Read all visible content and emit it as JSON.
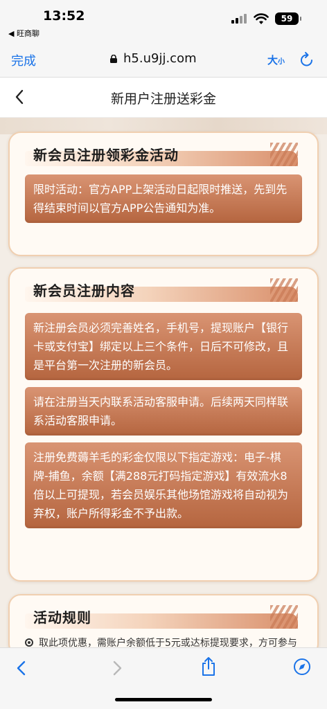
{
  "status": {
    "time": "13:52",
    "back_app": "◀ 旺商聊",
    "battery": "59"
  },
  "browser": {
    "done": "完成",
    "url": "h5.u9jj.com",
    "text_size_big": "大",
    "text_size_small": "小"
  },
  "header": {
    "title": "新用户注册送彩金"
  },
  "cards": [
    {
      "title": "新会员注册领彩金活动",
      "paragraphs": [
        "限时活动：官方APP上架活动日起限时推送，先到先得结束时间以官方APP公告通知为准。"
      ]
    },
    {
      "title": "新会员注册内容",
      "paragraphs": [
        "新注册会员必须完善姓名，手机号，提现账户【银行卡或支付宝】绑定以上三个条件，日后不可修改，且是平台第一次注册的新会员。",
        "请在注册当天内联系活动客服申请。后续两天同样联系活动客服申请。",
        "注册免费薅羊毛的彩金仅限以下指定游戏：电子-棋牌-捕鱼，余额【满288元打码指定游戏】有效流水8倍以上可提现，若会员娱乐其他场馆游戏将自动视为弃权，账户所得彩金不予出款。"
      ]
    },
    {
      "title": "活动规则",
      "rule": "取此项优惠，需账户余额低于5元或达标提现要求，方可参与"
    }
  ]
}
